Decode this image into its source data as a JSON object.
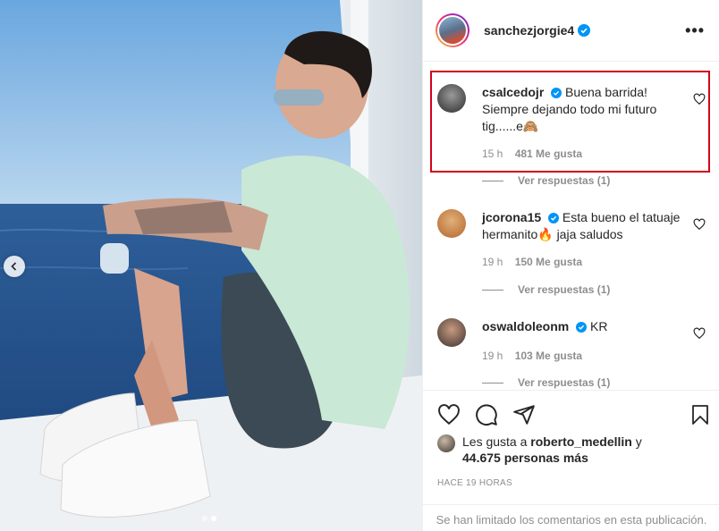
{
  "post": {
    "author": "sanchezjorgie4",
    "more_label": "•••"
  },
  "comments": [
    {
      "user": "csalcedojr",
      "text": "Buena barrida! Siempre dejando todo mi futuro tig......e🙈",
      "time": "15 h",
      "likes": "481 Me gusta",
      "replies": "Ver respuestas (1)",
      "highlighted": true
    },
    {
      "user": "jcorona15",
      "text": "Esta bueno el tatuaje hermanito🔥 jaja saludos",
      "time": "19 h",
      "likes": "150 Me gusta",
      "replies": "Ver respuestas (1)"
    },
    {
      "user": "oswaldoleonm",
      "text": "KR",
      "time": "19 h",
      "likes": "103 Me gusta",
      "replies": "Ver respuestas (1)"
    }
  ],
  "likes_summary": {
    "prefix": "Les gusta a",
    "user": "roberto_medellin",
    "connector": "y",
    "others": "44.675 personas más"
  },
  "posted_time": "HACE 19 HORAS",
  "comments_limited": "Se han limitado los comentarios en esta publicación.",
  "carousel": {
    "current": 2,
    "total": 2
  },
  "colors": {
    "verified": "#0095f6",
    "highlight": "#d0021b",
    "muted": "#8e8e8e"
  }
}
